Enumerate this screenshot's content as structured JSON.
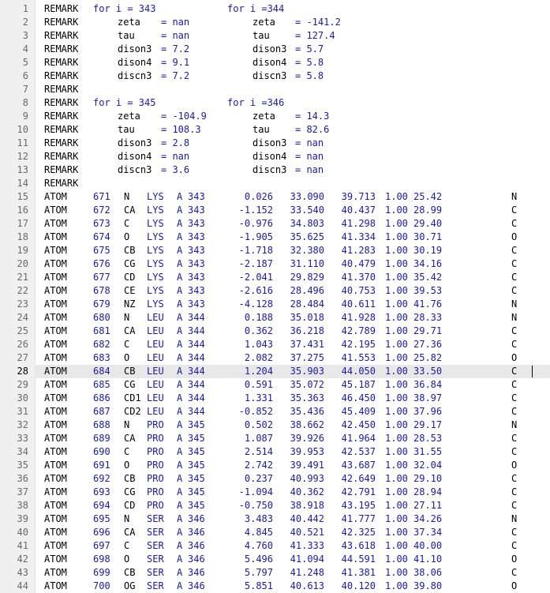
{
  "editor": {
    "current_line": 28,
    "remark_lines": [
      {
        "n": "1",
        "f": [
          "REMARK",
          "for i = 343",
          "",
          "",
          "for i =344",
          "",
          ""
        ]
      },
      {
        "n": "2",
        "f": [
          "REMARK",
          "",
          "zeta",
          "= nan",
          "",
          "zeta",
          "= -141.2"
        ]
      },
      {
        "n": "3",
        "f": [
          "REMARK",
          "",
          "tau",
          "= nan",
          "",
          "tau",
          "= 127.4"
        ]
      },
      {
        "n": "4",
        "f": [
          "REMARK",
          "",
          "dison3",
          "= 7.2",
          "",
          "dison3",
          "= 5.7"
        ]
      },
      {
        "n": "5",
        "f": [
          "REMARK",
          "",
          "dison4",
          "= 9.1",
          "",
          "dison4",
          "= 5.8"
        ]
      },
      {
        "n": "6",
        "f": [
          "REMARK",
          "",
          "discn3",
          "= 7.2",
          "",
          "discn3",
          "= 5.8"
        ]
      },
      {
        "n": "7",
        "f": [
          "REMARK",
          "",
          "",
          "",
          "",
          "",
          ""
        ]
      },
      {
        "n": "8",
        "f": [
          "REMARK",
          "for i = 345",
          "",
          "",
          "for i =346",
          "",
          ""
        ]
      },
      {
        "n": "9",
        "f": [
          "REMARK",
          "",
          "zeta",
          "= -104.9",
          "",
          "zeta",
          "= 14.3"
        ]
      },
      {
        "n": "10",
        "f": [
          "REMARK",
          "",
          "tau",
          "= 108.3",
          "",
          "tau",
          "= 82.6"
        ]
      },
      {
        "n": "11",
        "f": [
          "REMARK",
          "",
          "dison3",
          "= 2.8",
          "",
          "dison3",
          "= nan"
        ]
      },
      {
        "n": "12",
        "f": [
          "REMARK",
          "",
          "dison4",
          "= nan",
          "",
          "dison4",
          "= nan"
        ]
      },
      {
        "n": "13",
        "f": [
          "REMARK",
          "",
          "discn3",
          "= 3.6",
          "",
          "discn3",
          "= nan"
        ]
      },
      {
        "n": "14",
        "f": [
          "REMARK",
          "",
          "",
          "",
          "",
          "",
          ""
        ]
      }
    ],
    "atom_lines": [
      {
        "n": "15",
        "f": [
          "ATOM",
          "671",
          "N",
          "LYS",
          "A",
          "343",
          "0.026",
          "33.090",
          "39.713",
          "1.00",
          "25.42",
          "N"
        ]
      },
      {
        "n": "16",
        "f": [
          "ATOM",
          "672",
          "CA",
          "LYS",
          "A",
          "343",
          "-1.152",
          "33.540",
          "40.437",
          "1.00",
          "28.99",
          "C"
        ]
      },
      {
        "n": "17",
        "f": [
          "ATOM",
          "673",
          "C",
          "LYS",
          "A",
          "343",
          "-0.976",
          "34.803",
          "41.298",
          "1.00",
          "29.40",
          "C"
        ]
      },
      {
        "n": "18",
        "f": [
          "ATOM",
          "674",
          "O",
          "LYS",
          "A",
          "343",
          "-1.905",
          "35.625",
          "41.334",
          "1.00",
          "30.71",
          "O"
        ]
      },
      {
        "n": "19",
        "f": [
          "ATOM",
          "675",
          "CB",
          "LYS",
          "A",
          "343",
          "-1.718",
          "32.380",
          "41.283",
          "1.00",
          "30.19",
          "C"
        ]
      },
      {
        "n": "20",
        "f": [
          "ATOM",
          "676",
          "CG",
          "LYS",
          "A",
          "343",
          "-2.187",
          "31.110",
          "40.479",
          "1.00",
          "34.16",
          "C"
        ]
      },
      {
        "n": "21",
        "f": [
          "ATOM",
          "677",
          "CD",
          "LYS",
          "A",
          "343",
          "-2.041",
          "29.829",
          "41.370",
          "1.00",
          "35.42",
          "C"
        ]
      },
      {
        "n": "22",
        "f": [
          "ATOM",
          "678",
          "CE",
          "LYS",
          "A",
          "343",
          "-2.616",
          "28.496",
          "40.753",
          "1.00",
          "39.53",
          "C"
        ]
      },
      {
        "n": "23",
        "f": [
          "ATOM",
          "679",
          "NZ",
          "LYS",
          "A",
          "343",
          "-4.128",
          "28.484",
          "40.611",
          "1.00",
          "41.76",
          "N"
        ]
      },
      {
        "n": "24",
        "f": [
          "ATOM",
          "680",
          "N",
          "LEU",
          "A",
          "344",
          "0.188",
          "35.018",
          "41.928",
          "1.00",
          "28.33",
          "N"
        ]
      },
      {
        "n": "25",
        "f": [
          "ATOM",
          "681",
          "CA",
          "LEU",
          "A",
          "344",
          "0.362",
          "36.218",
          "42.789",
          "1.00",
          "29.71",
          "C"
        ]
      },
      {
        "n": "26",
        "f": [
          "ATOM",
          "682",
          "C",
          "LEU",
          "A",
          "344",
          "1.043",
          "37.431",
          "42.195",
          "1.00",
          "27.36",
          "C"
        ]
      },
      {
        "n": "27",
        "f": [
          "ATOM",
          "683",
          "O",
          "LEU",
          "A",
          "344",
          "2.082",
          "37.275",
          "41.553",
          "1.00",
          "25.82",
          "O"
        ]
      },
      {
        "n": "28",
        "f": [
          "ATOM",
          "684",
          "CB",
          "LEU",
          "A",
          "344",
          "1.204",
          "35.903",
          "44.050",
          "1.00",
          "33.50",
          "C"
        ]
      },
      {
        "n": "29",
        "f": [
          "ATOM",
          "685",
          "CG",
          "LEU",
          "A",
          "344",
          "0.591",
          "35.072",
          "45.187",
          "1.00",
          "36.84",
          "C"
        ]
      },
      {
        "n": "30",
        "f": [
          "ATOM",
          "686",
          "CD1",
          "LEU",
          "A",
          "344",
          "1.331",
          "35.363",
          "46.450",
          "1.00",
          "38.97",
          "C"
        ]
      },
      {
        "n": "31",
        "f": [
          "ATOM",
          "687",
          "CD2",
          "LEU",
          "A",
          "344",
          "-0.852",
          "35.436",
          "45.409",
          "1.00",
          "37.96",
          "C"
        ]
      },
      {
        "n": "32",
        "f": [
          "ATOM",
          "688",
          "N",
          "PRO",
          "A",
          "345",
          "0.502",
          "38.662",
          "42.450",
          "1.00",
          "29.17",
          "N"
        ]
      },
      {
        "n": "33",
        "f": [
          "ATOM",
          "689",
          "CA",
          "PRO",
          "A",
          "345",
          "1.087",
          "39.926",
          "41.964",
          "1.00",
          "28.53",
          "C"
        ]
      },
      {
        "n": "34",
        "f": [
          "ATOM",
          "690",
          "C",
          "PRO",
          "A",
          "345",
          "2.514",
          "39.953",
          "42.537",
          "1.00",
          "31.55",
          "C"
        ]
      },
      {
        "n": "35",
        "f": [
          "ATOM",
          "691",
          "O",
          "PRO",
          "A",
          "345",
          "2.742",
          "39.491",
          "43.687",
          "1.00",
          "32.04",
          "O"
        ]
      },
      {
        "n": "36",
        "f": [
          "ATOM",
          "692",
          "CB",
          "PRO",
          "A",
          "345",
          "0.237",
          "40.993",
          "42.649",
          "1.00",
          "29.10",
          "C"
        ]
      },
      {
        "n": "37",
        "f": [
          "ATOM",
          "693",
          "CG",
          "PRO",
          "A",
          "345",
          "-1.094",
          "40.362",
          "42.791",
          "1.00",
          "28.94",
          "C"
        ]
      },
      {
        "n": "38",
        "f": [
          "ATOM",
          "694",
          "CD",
          "PRO",
          "A",
          "345",
          "-0.750",
          "38.918",
          "43.195",
          "1.00",
          "27.11",
          "C"
        ]
      },
      {
        "n": "39",
        "f": [
          "ATOM",
          "695",
          "N",
          "SER",
          "A",
          "346",
          "3.483",
          "40.442",
          "41.777",
          "1.00",
          "34.26",
          "N"
        ]
      },
      {
        "n": "40",
        "f": [
          "ATOM",
          "696",
          "CA",
          "SER",
          "A",
          "346",
          "4.845",
          "40.521",
          "42.325",
          "1.00",
          "37.34",
          "C"
        ]
      },
      {
        "n": "41",
        "f": [
          "ATOM",
          "697",
          "C",
          "SER",
          "A",
          "346",
          "4.760",
          "41.333",
          "43.618",
          "1.00",
          "40.00",
          "C"
        ]
      },
      {
        "n": "42",
        "f": [
          "ATOM",
          "698",
          "O",
          "SER",
          "A",
          "346",
          "5.496",
          "41.094",
          "44.591",
          "1.00",
          "41.10",
          "O"
        ]
      },
      {
        "n": "43",
        "f": [
          "ATOM",
          "699",
          "CB",
          "SER",
          "A",
          "346",
          "5.797",
          "41.248",
          "41.381",
          "1.00",
          "38.06",
          "C"
        ]
      },
      {
        "n": "44",
        "f": [
          "ATOM",
          "700",
          "OG",
          "SER",
          "A",
          "346",
          "5.851",
          "40.613",
          "40.120",
          "1.00",
          "39.80",
          "O"
        ]
      }
    ]
  },
  "colors": {
    "keyword": "#000000",
    "value": "#1a1aa6",
    "gutter_bg": "#f0f0f0",
    "current_line_bg": "#e8e8e8"
  }
}
